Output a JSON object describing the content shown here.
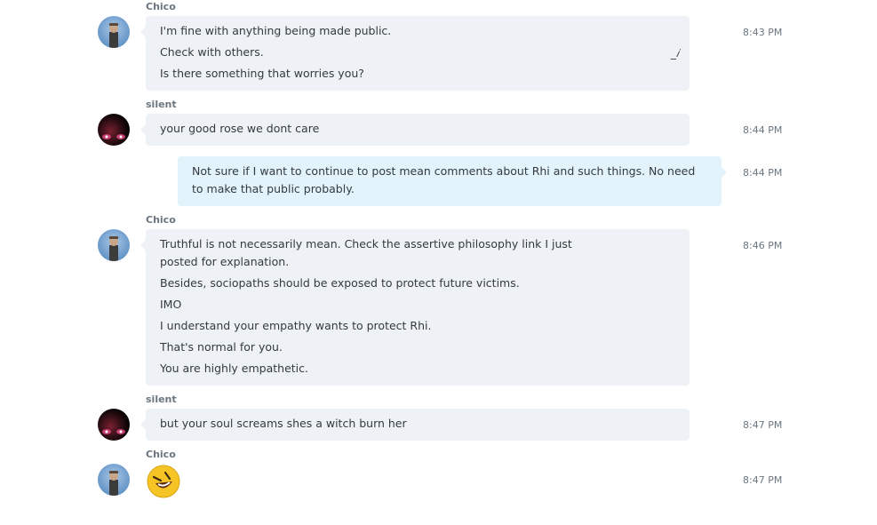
{
  "messages": [
    {
      "sender": "Chico",
      "lines": [
        "I'm fine with anything being made public.",
        "Check with others.",
        "Is there something that worries you?"
      ],
      "time": "8:43 PM"
    },
    {
      "sender": "silent",
      "lines": [
        "your good rose we dont care"
      ],
      "time": "8:44 PM"
    },
    {
      "sender": "",
      "lines": [
        "Not sure if I want to continue to post mean comments about Rhi and such things.  No need to make that public probably."
      ],
      "time": "8:44 PM"
    },
    {
      "sender": "Chico",
      "lines": [
        "Truthful is not necessarily mean.  Check the assertive philosophy link I just posted for explanation.",
        "Besides, sociopaths should be exposed to protect future victims.",
        "IMO",
        "I understand your empathy wants to protect Rhi.",
        "That's normal for you.",
        "You are highly empathetic."
      ],
      "time": "8:46 PM"
    },
    {
      "sender": "silent",
      "lines": [
        "but your soul screams shes a witch burn her"
      ],
      "time": "8:47 PM"
    },
    {
      "sender": "Chico",
      "emoji": "laughing-emoji",
      "time": "8:47 PM"
    }
  ],
  "colors": {
    "bubble_other": "#eef2f7",
    "bubble_me": "#e3f3fb",
    "sender_text": "#6b7680"
  }
}
